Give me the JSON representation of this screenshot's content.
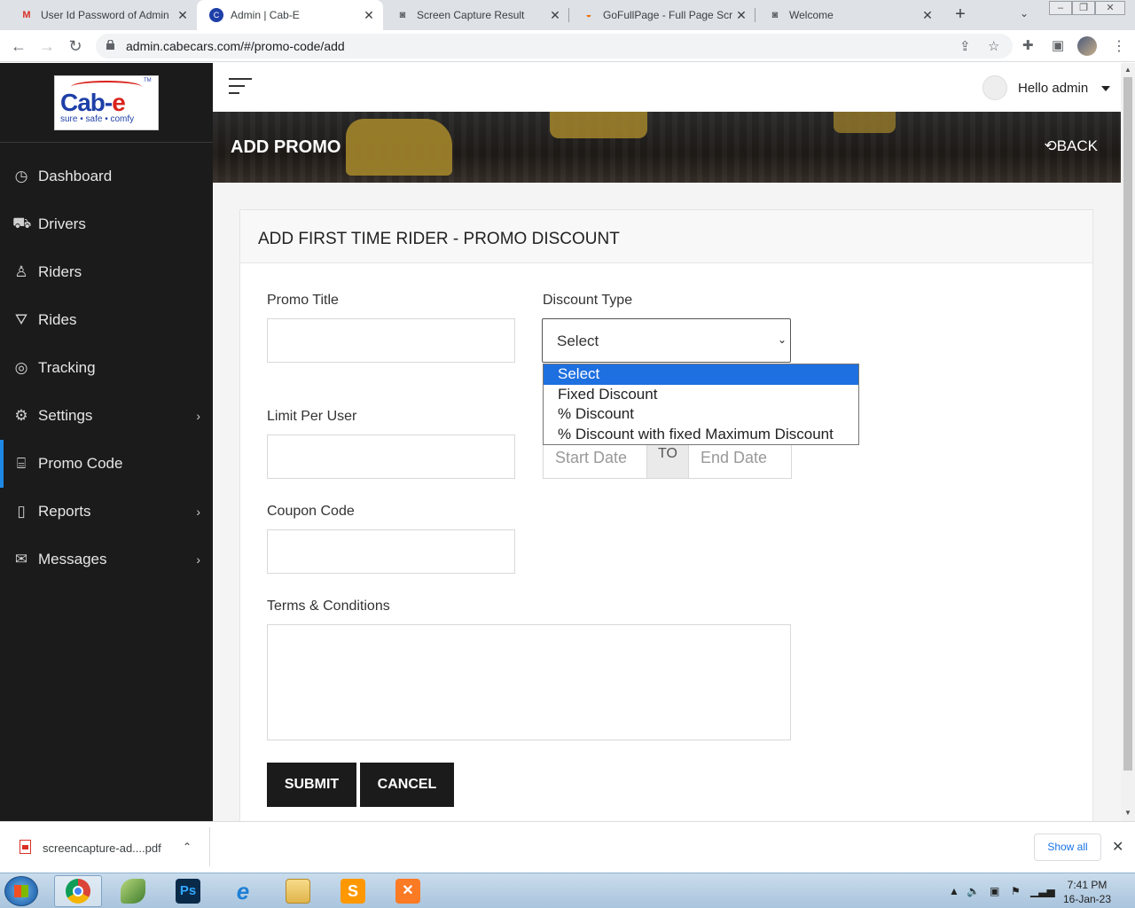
{
  "browser": {
    "tabs": [
      {
        "label": "User Id Password of Admin",
        "icon": "gmail-icon"
      },
      {
        "label": "Admin | Cab-E",
        "icon": "cabe-icon"
      },
      {
        "label": "Screen Capture Result",
        "icon": "camera-icon"
      },
      {
        "label": "GoFullPage - Full Page Scre",
        "icon": "gofullpage-icon"
      },
      {
        "label": "Welcome",
        "icon": "camera-icon"
      }
    ],
    "url": "admin.cabecars.com/#/promo-code/add"
  },
  "sidebar": {
    "logo": {
      "main_left": "Cab-",
      "main_right": "e",
      "tagline": "sure • safe • comfy",
      "tm": "TM"
    },
    "items": [
      {
        "label": "Dashboard",
        "icon": "clock-icon"
      },
      {
        "label": "Drivers",
        "icon": "car-icon"
      },
      {
        "label": "Riders",
        "icon": "user-icon"
      },
      {
        "label": "Rides",
        "icon": "road-icon"
      },
      {
        "label": "Tracking",
        "icon": "target-icon"
      },
      {
        "label": "Settings",
        "icon": "gear-icon"
      },
      {
        "label": "Promo Code",
        "icon": "gift-icon"
      },
      {
        "label": "Reports",
        "icon": "file-icon"
      },
      {
        "label": "Messages",
        "icon": "envelope-icon"
      }
    ]
  },
  "header": {
    "greeting": "Hello admin"
  },
  "banner": {
    "title": "ADD PROMO",
    "back_label": "BACK"
  },
  "form": {
    "title": "ADD FIRST TIME RIDER - PROMO DISCOUNT",
    "promo_title_label": "Promo Title",
    "discount_type_label": "Discount Type",
    "discount_type_value": "Select",
    "discount_options": [
      "Select",
      "Fixed Discount",
      "% Discount",
      "% Discount with fixed Maximum Discount"
    ],
    "limit_label": "Limit Per User",
    "start_date_placeholder": "Start Date",
    "to_label": "TO",
    "end_date_placeholder": "End Date",
    "coupon_label": "Coupon Code",
    "terms_label": "Terms & Conditions",
    "submit_label": "SUBMIT",
    "cancel_label": "CANCEL"
  },
  "downloads": {
    "file_name": "screencapture-ad....pdf",
    "show_all": "Show all"
  },
  "taskbar": {
    "time": "7:41 PM",
    "date": "16-Jan-23"
  },
  "colors": {
    "sidebar_bg": "#1b1b1b",
    "active_accent": "#1e88e5",
    "selected_option": "#1e6fe0",
    "button_bg": "#1b1b1b"
  }
}
